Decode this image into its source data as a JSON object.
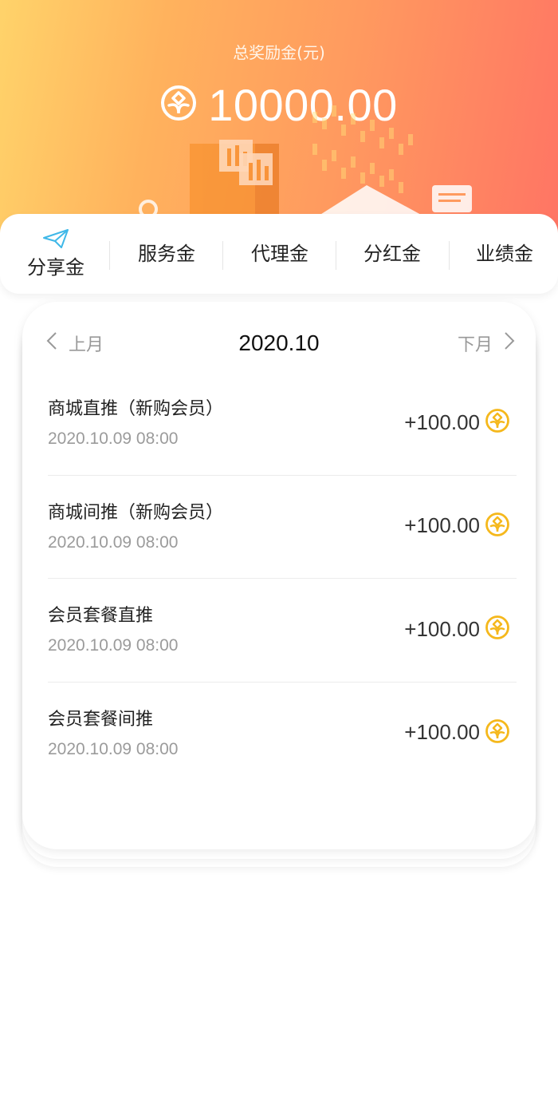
{
  "header": {
    "title": "总奖励金(元)",
    "total": "10000.00",
    "coin_icon": "coin-leaf-icon"
  },
  "tabs": [
    {
      "label": "分享金",
      "active": true,
      "icon": "paper-plane-icon"
    },
    {
      "label": "服务金",
      "active": false
    },
    {
      "label": "代理金",
      "active": false
    },
    {
      "label": "分红金",
      "active": false
    },
    {
      "label": "业绩金",
      "active": false
    }
  ],
  "month_nav": {
    "prev_label": "上月",
    "current": "2020.10",
    "next_label": "下月"
  },
  "records": [
    {
      "title": "商城直推（新购会员）",
      "time": "2020.10.09 08:00",
      "amount": "+100.00"
    },
    {
      "title": "商城间推（新购会员）",
      "time": "2020.10.09 08:00",
      "amount": "+100.00"
    },
    {
      "title": "会员套餐直推",
      "time": "2020.10.09 08:00",
      "amount": "+100.00"
    },
    {
      "title": "会员套餐间推",
      "time": "2020.10.09 08:00",
      "amount": "+100.00"
    }
  ],
  "colors": {
    "header_gradient_start": "#ffd36a",
    "header_gradient_end": "#ff7464",
    "coin_gold": "#f5b81c",
    "active_icon": "#3fb8e8"
  }
}
